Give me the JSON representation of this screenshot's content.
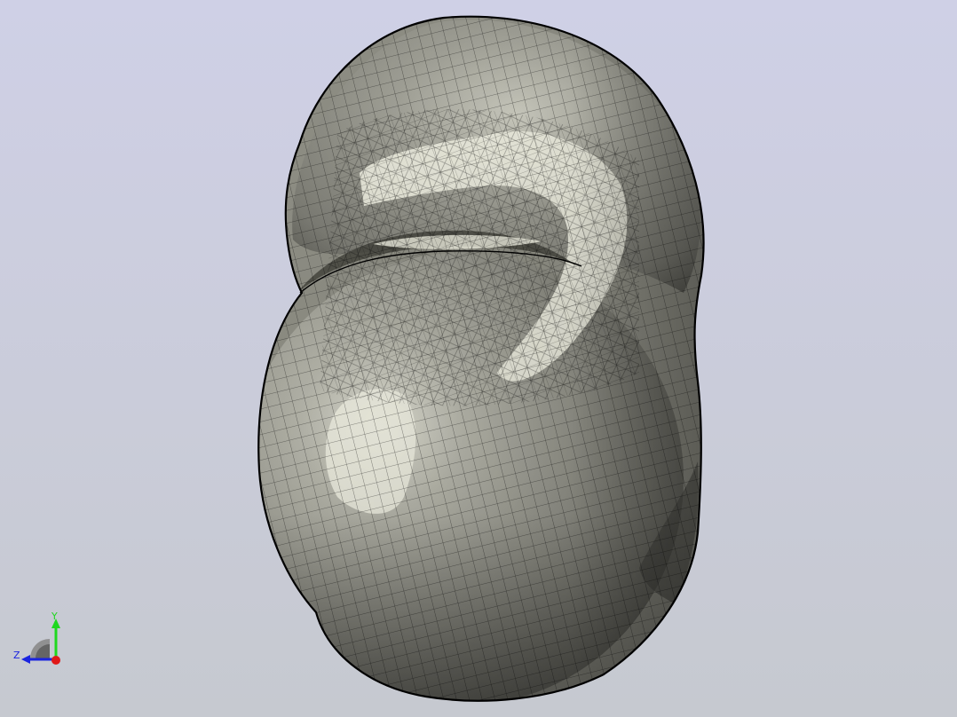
{
  "viewport": {
    "background_top": "#cfd0e6",
    "background_bottom": "#c6c9d0",
    "model": {
      "surface_color": "#8f8f85",
      "highlight_color": "#f4f4e6",
      "shadow_color": "#55554e",
      "mesh_line_color": "#000000",
      "display_mode": "shaded-with-mesh-edges"
    }
  },
  "triad": {
    "y_label": "Y",
    "z_label": "Z",
    "y_color": "#1fd81f",
    "z_color": "#1a24e0",
    "x_color": "#e01818",
    "base_color": "#8a8a8a"
  }
}
